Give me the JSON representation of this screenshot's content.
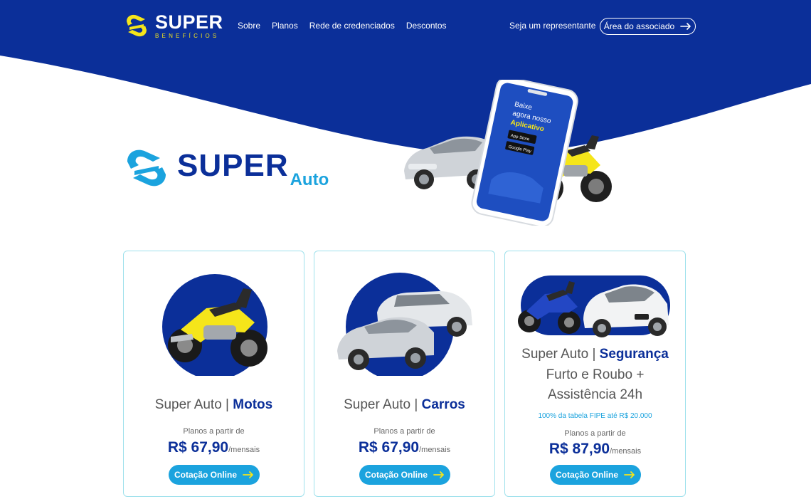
{
  "colors": {
    "primary": "#0b2f99",
    "accent": "#1ba3de",
    "highlight": "#f5e51a",
    "card_border": "#9fe1ec"
  },
  "header": {
    "logo_text": "SUPER",
    "logo_subtext": "BENEFÍCIOS",
    "nav": [
      "Sobre",
      "Planos",
      "Rede de credenciados",
      "Descontos"
    ],
    "representative_link": "Seja um representante",
    "associate_button": "Área do associado"
  },
  "hero": {
    "brand_super": "SUPER",
    "brand_auto": "Auto",
    "phone_lines": [
      "Baixe",
      "agora nosso",
      "Aplicativo"
    ],
    "store_badges": [
      "App Store",
      "Google Play"
    ]
  },
  "cards": [
    {
      "title_prefix": "Super Auto | ",
      "title_accent": "Motos",
      "from_label": "Planos a partir de",
      "price": "R$ 67,90",
      "period": "/mensais",
      "button": "Cotação Online"
    },
    {
      "title_prefix": "Super Auto | ",
      "title_accent": "Carros",
      "from_label": "Planos a partir de",
      "price": "R$ 67,90",
      "period": "/mensais",
      "button": "Cotação Online"
    },
    {
      "title_prefix": "Super Auto | ",
      "title_accent": "Segurança",
      "subtitle_line1": "Furto e Roubo +",
      "subtitle_line2": "Assistência 24h",
      "note": "100% da tabela FIPE até R$ 20.000",
      "from_label": "Planos a partir de",
      "price": "R$ 87,90",
      "period": "/mensais",
      "button": "Cotação Online"
    }
  ],
  "icons": {
    "logo": "super-logo-icon",
    "arrow": "arrow-right-icon",
    "moto": "motorcycle-icon",
    "car": "car-icon",
    "phone": "smartphone-icon"
  }
}
